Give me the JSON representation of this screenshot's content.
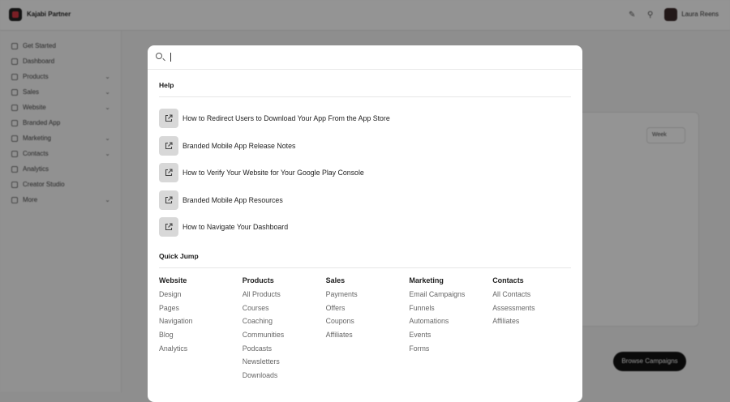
{
  "app": {
    "brand": "Kajabi Partner",
    "user": "Laura Reens"
  },
  "sidebar": {
    "items": [
      {
        "label": "Get Started",
        "chevron": false
      },
      {
        "label": "Dashboard",
        "chevron": false
      },
      {
        "label": "Products",
        "chevron": true
      },
      {
        "label": "Sales",
        "chevron": true
      },
      {
        "label": "Website",
        "chevron": true
      },
      {
        "label": "Branded App",
        "chevron": false
      },
      {
        "label": "Marketing",
        "chevron": true
      },
      {
        "label": "Contacts",
        "chevron": true
      },
      {
        "label": "Analytics",
        "chevron": false
      },
      {
        "label": "Creator Studio",
        "chevron": false
      },
      {
        "label": "More",
        "chevron": true
      }
    ]
  },
  "background": {
    "period_select": "Week",
    "browse_button": "Browse Campaigns"
  },
  "search": {
    "placeholder": "",
    "value": ""
  },
  "help": {
    "title": "Help",
    "items": [
      "How to Redirect Users to Download Your App From the App Store",
      "Branded Mobile App Release Notes",
      "How to Verify Your Website for Your Google Play Console",
      "Branded Mobile App Resources",
      "How to Navigate Your Dashboard"
    ]
  },
  "quick_jump": {
    "title": "Quick Jump",
    "columns": [
      {
        "heading": "Website",
        "links": [
          "Design",
          "Pages",
          "Navigation",
          "Blog",
          "Analytics"
        ]
      },
      {
        "heading": "Products",
        "links": [
          "All Products",
          "Courses",
          "Coaching",
          "Communities",
          "Podcasts",
          "Newsletters",
          "Downloads"
        ]
      },
      {
        "heading": "Sales",
        "links": [
          "Payments",
          "Offers",
          "Coupons",
          "Affiliates"
        ]
      },
      {
        "heading": "Marketing",
        "links": [
          "Email Campaigns",
          "Funnels",
          "Automations",
          "Events",
          "Forms"
        ]
      },
      {
        "heading": "Contacts",
        "links": [
          "All Contacts",
          "Assessments",
          "Affiliates"
        ]
      }
    ]
  }
}
